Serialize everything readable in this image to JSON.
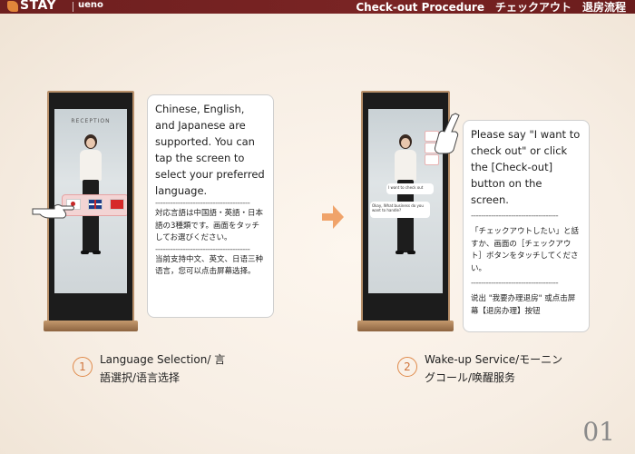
{
  "header": {
    "brand": "STAY",
    "brand_sub": "ueno",
    "title": "Check-out Procedure　チェックアウト　退房流程"
  },
  "kiosk1": {
    "screen_title": "RECEPTION",
    "languages": [
      "jp-flag-icon",
      "uk-flag-icon",
      "cn-flag-icon"
    ]
  },
  "kiosk2": {
    "chat_user": "I want to check out",
    "chat_bot": "Okay, What business do you want to handle?"
  },
  "callout1": {
    "en": "Chinese, English, and Japanese are supported. You can tap the screen to select your preferred language.",
    "divider1": "--------------------------------------",
    "ja": "対応言語は中国語・英語・日本語の3種類です。画面をタッチしてお選びください。",
    "divider2": "--------------------------------------",
    "zh": "当前支持中文、英文、日语三种语言，您可以点击屏幕选择。"
  },
  "callout2": {
    "en": "Please say \"I want to check out\" or click the [Check-out] button on the screen.",
    "divider1": "-----------------------------------",
    "ja": "「チェックアウトしたい」と話すか、画面の［チェックアウト］ボタンをタッチしてください。",
    "divider2": "-----------------------------------",
    "zh": "说出 \"我要办理退房\" 或点击屏幕【退房办理】按钮"
  },
  "steps": [
    {
      "number": "1",
      "label": "Language Selection/ 言語選択/语言选择"
    },
    {
      "number": "2",
      "label": "Wake-up Service/モーニングコール/唤醒服务"
    }
  ],
  "page_number": "01",
  "colors": {
    "header_bg": "#6e1f1f",
    "accent_orange": "#e08a4b",
    "kiosk_gold": "#b8906a"
  }
}
